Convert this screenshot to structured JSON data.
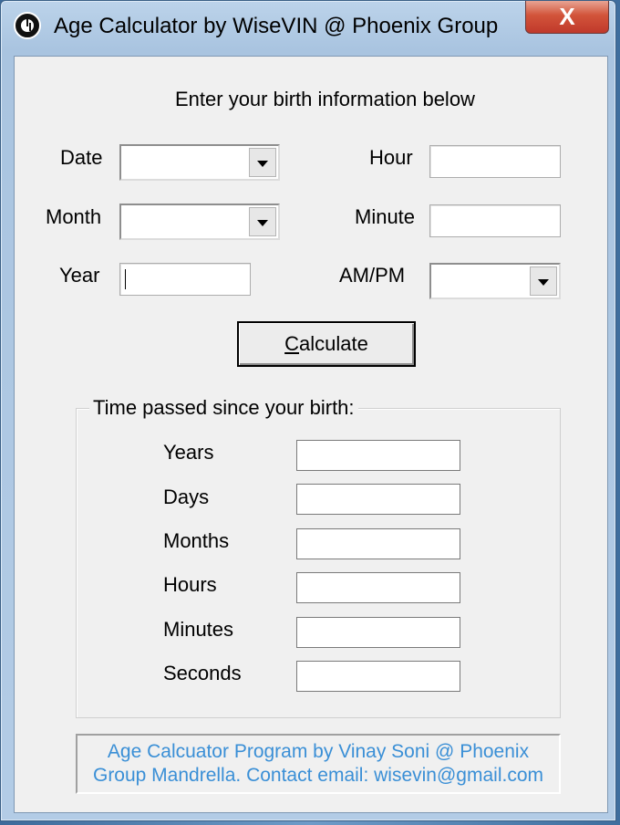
{
  "window": {
    "title": "Age Calculator by WiseVIN @ Phoenix Group",
    "close_label": "X"
  },
  "form": {
    "heading": "Enter your birth information below",
    "date_label": "Date",
    "month_label": "Month",
    "year_label": "Year",
    "hour_label": "Hour",
    "minute_label": "Minute",
    "ampm_label": "AM/PM",
    "date_value": "",
    "month_value": "",
    "year_value": "",
    "hour_value": "",
    "minute_value": "",
    "ampm_value": "",
    "calculate_prefix": "C",
    "calculate_rest": "alculate"
  },
  "results": {
    "group_title": "Time passed since your birth:",
    "years_label": "Years",
    "days_label": "Days",
    "months_label": "Months",
    "hours_label": "Hours",
    "minutes_label": "Minutes",
    "seconds_label": "Seconds",
    "years_value": "",
    "days_value": "",
    "months_value": "",
    "hours_value": "",
    "minutes_value": "",
    "seconds_value": ""
  },
  "footer": {
    "line1": "Age Calcuator Program by Vinay Soni @ Phoenix",
    "line2": "Group Mandrella. Contact email: wisevin@gmail.com"
  },
  "colors": {
    "footer_text": "#3a8fd6",
    "close_button": "#c0392b",
    "client_bg": "#f0f0f0"
  },
  "icons": {
    "app": "clock-icon",
    "close": "close-icon",
    "dropdown": "chevron-down-icon"
  }
}
